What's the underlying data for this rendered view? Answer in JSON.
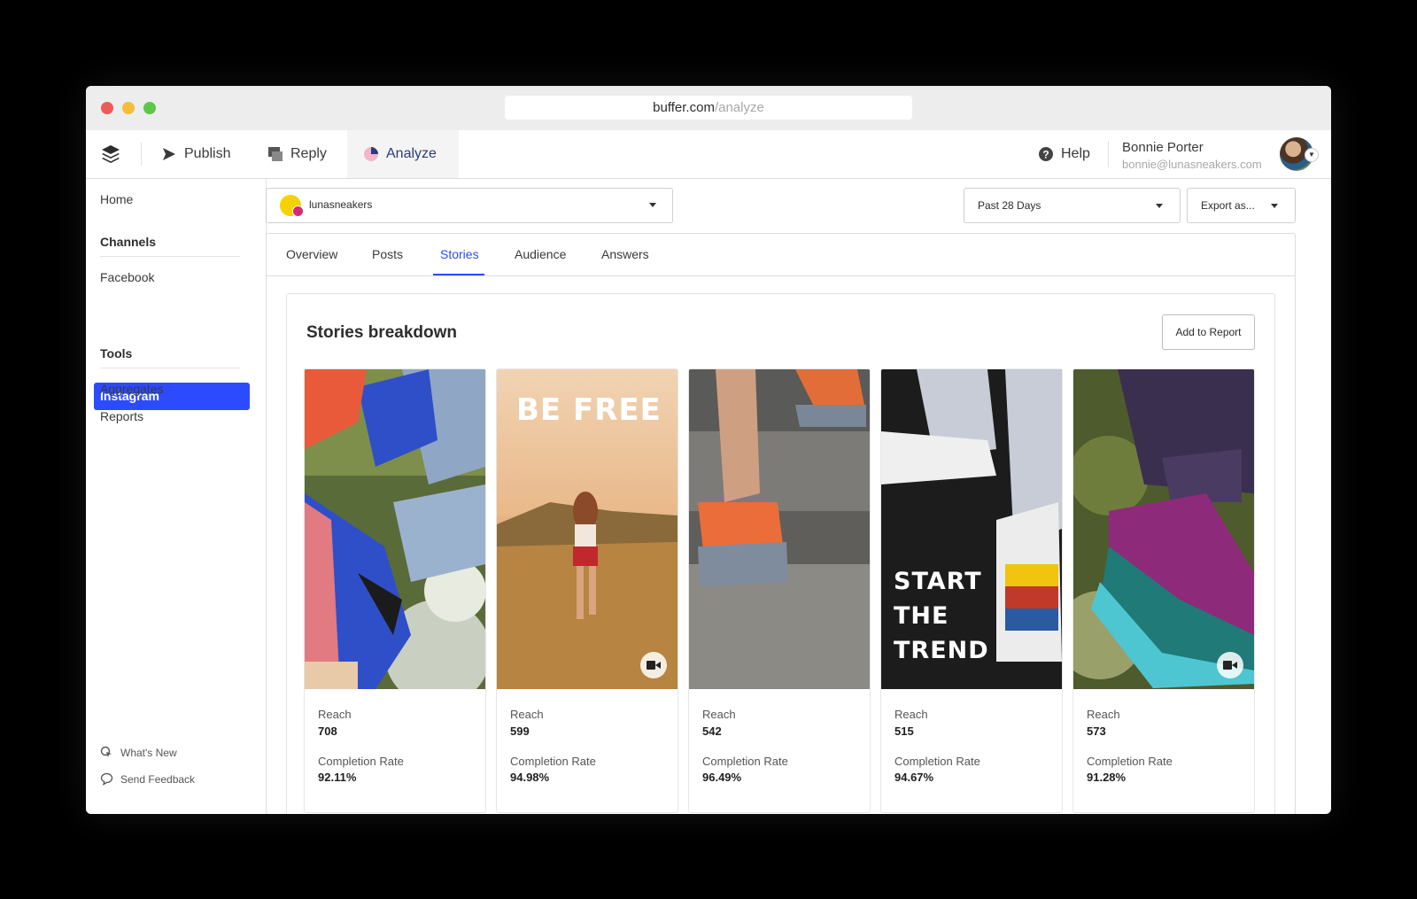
{
  "browser": {
    "url_host": "buffer.com",
    "url_path": "/analyze"
  },
  "nav": {
    "publish": "Publish",
    "reply": "Reply",
    "analyze": "Analyze",
    "help": "Help",
    "user_name": "Bonnie Porter",
    "user_email": "bonnie@lunasneakers.com"
  },
  "sidebar": {
    "home": "Home",
    "channels_heading": "Channels",
    "facebook": "Facebook",
    "instagram": "Instagram",
    "tools_heading": "Tools",
    "aggregates": "Aggregates",
    "reports": "Reports",
    "whats_new": "What's New",
    "send_feedback": "Send Feedback"
  },
  "channel_selector": {
    "value": "lunasneakers"
  },
  "date_selector": {
    "value": "Past 28 Days"
  },
  "export_selector": {
    "value": "Export as..."
  },
  "tabs": [
    "Overview",
    "Posts",
    "Stories",
    "Audience",
    "Answers"
  ],
  "active_tab": "Stories",
  "stories": {
    "title": "Stories breakdown",
    "add_to_report": "Add to Report",
    "reach_label": "Reach",
    "completion_label": "Completion Rate",
    "items": [
      {
        "reach": "708",
        "completion": "92.11%",
        "video": false,
        "overlay": []
      },
      {
        "reach": "599",
        "completion": "94.98%",
        "video": true,
        "overlay": [
          "BE FREE"
        ]
      },
      {
        "reach": "542",
        "completion": "96.49%",
        "video": false,
        "overlay": []
      },
      {
        "reach": "515",
        "completion": "94.67%",
        "video": false,
        "overlay": [
          "START",
          "THE",
          "TREND"
        ]
      },
      {
        "reach": "573",
        "completion": "91.28%",
        "video": true,
        "overlay": []
      }
    ]
  },
  "colors": {
    "accent": "#2c4bff",
    "analyze_text": "#2c3a7d"
  }
}
